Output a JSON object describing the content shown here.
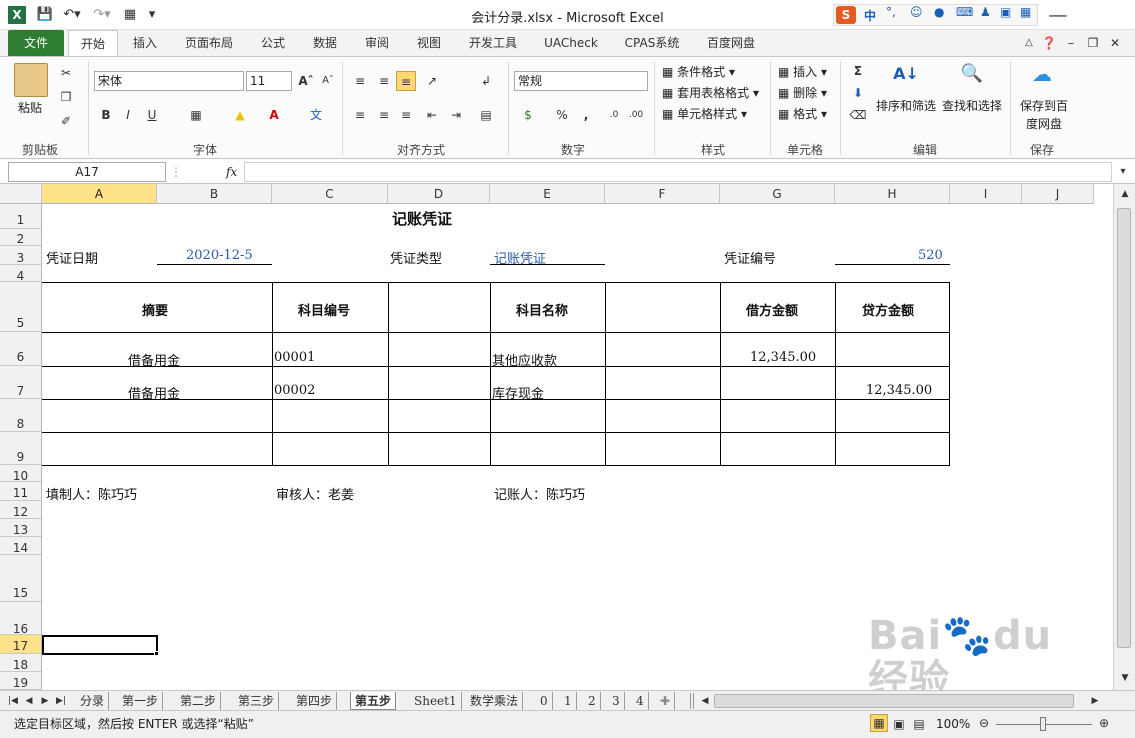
{
  "window": {
    "title": "会计分录.xlsx - Microsoft Excel",
    "ime_label": "中"
  },
  "ribbon_tabs": [
    "文件",
    "开始",
    "插入",
    "页面布局",
    "公式",
    "数据",
    "审阅",
    "视图",
    "开发工具",
    "UACheck",
    "CPAS系统",
    "百度网盘"
  ],
  "ribbon": {
    "clipboard": {
      "paste": "粘贴",
      "label": "剪贴板"
    },
    "font": {
      "name": "宋体",
      "size": "11",
      "label": "字体"
    },
    "alignment": {
      "label": "对齐方式"
    },
    "number": {
      "format": "常规",
      "label": "数字"
    },
    "styles": {
      "conditional": "条件格式",
      "table": "套用表格格式",
      "cell": "单元格样式",
      "label": "样式"
    },
    "cells": {
      "insert": "插入",
      "delete": "删除",
      "format": "格式",
      "label": "单元格"
    },
    "editing": {
      "sort": "排序和筛选",
      "find": "查找和选择",
      "label": "编辑"
    },
    "save": {
      "button": "保存到百度网盘",
      "label": "保存"
    }
  },
  "formula_bar": {
    "name_box": "A17",
    "fx": "fx",
    "formula": ""
  },
  "columns": [
    "A",
    "B",
    "C",
    "D",
    "E",
    "F",
    "G",
    "H",
    "I",
    "J"
  ],
  "rows": [
    "1",
    "2",
    "3",
    "4",
    "5",
    "6",
    "7",
    "8",
    "9",
    "10",
    "11",
    "12",
    "13",
    "14",
    "15",
    "16",
    "17",
    "18",
    "19"
  ],
  "voucher": {
    "title": "记账凭证",
    "date_label": "凭证日期",
    "date_value": "2020-12-5",
    "type_label": "凭证类型",
    "type_value": "记账凭证",
    "number_label": "凭证编号",
    "number_value": "520",
    "headers": {
      "summary": "摘要",
      "account_code": "科目编号",
      "account_name": "科目名称",
      "debit": "借方金额",
      "credit": "贷方金额"
    },
    "entries": [
      {
        "summary": "借备用金",
        "code": "00001",
        "name": "其他应收款",
        "debit": "12,345.00",
        "credit": ""
      },
      {
        "summary": "借备用金",
        "code": "00002",
        "name": "库存现金",
        "debit": "",
        "credit": "12,345.00"
      }
    ],
    "preparer": "填制人：陈巧巧",
    "reviewer": "审核人：老姜",
    "bookkeeper": "记账人：陈巧巧"
  },
  "sheet_tabs": [
    "分录",
    "第一步",
    "第二步",
    "第三步",
    "第四步",
    "第五步",
    "Sheet1",
    "数学乘法",
    "0",
    "1",
    "2",
    "3",
    "4"
  ],
  "active_sheet": "第五步",
  "status": {
    "message": "选定目标区域，然后按 ENTER 或选择“粘贴”",
    "zoom": "100%"
  },
  "watermark": "Bai du 经验 jingyan.baidu.com"
}
